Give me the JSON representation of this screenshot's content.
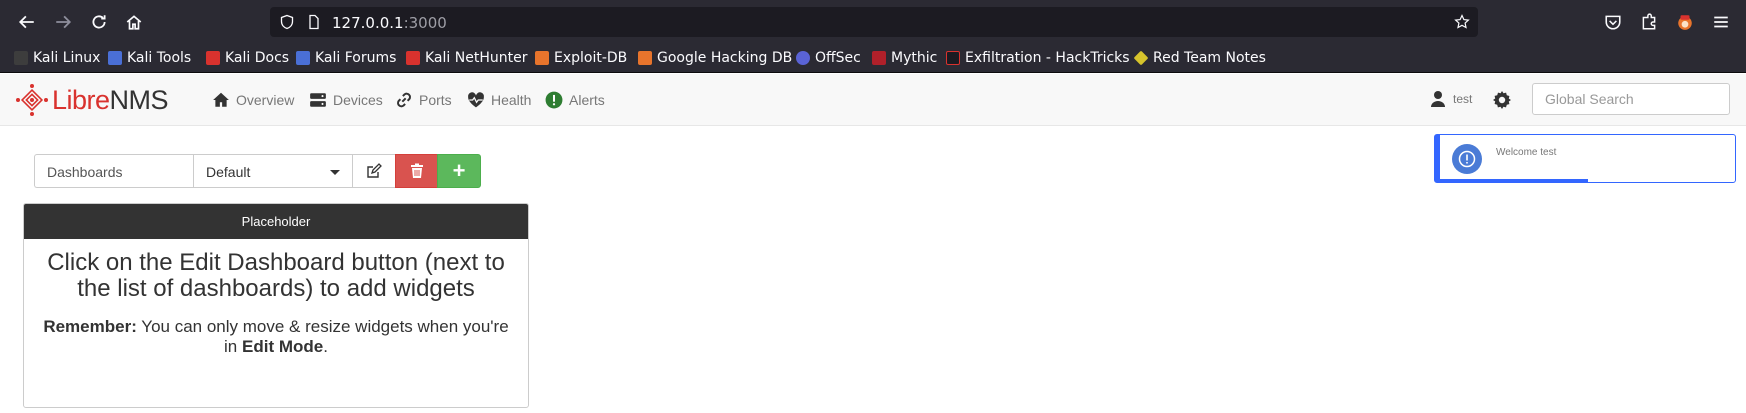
{
  "browser": {
    "url_host": "127.0.0.1",
    "url_port": ":3000",
    "bookmarks": [
      {
        "label": "Kali Linux",
        "color": "#3d3d3d"
      },
      {
        "label": "Kali Tools",
        "color": "#4a6fd6"
      },
      {
        "label": "Kali Docs",
        "color": "#d9322e"
      },
      {
        "label": "Kali Forums",
        "color": "#4a6fd6"
      },
      {
        "label": "Kali NetHunter",
        "color": "#d9322e"
      },
      {
        "label": "Exploit-DB",
        "color": "#e8742c"
      },
      {
        "label": "Google Hacking DB",
        "color": "#e8742c"
      },
      {
        "label": "OffSec",
        "color": "#5a63d6"
      },
      {
        "label": "Mythic",
        "color": "#b0202a"
      },
      {
        "label": "Exfiltration - HackTricks",
        "color": "#d9322e"
      },
      {
        "label": "Red Team Notes",
        "color": "#d6c32c"
      }
    ]
  },
  "navbar": {
    "logo_libre": "Libre",
    "logo_nms": "NMS",
    "items": [
      {
        "label": "Overview",
        "icon": "home-icon"
      },
      {
        "label": "Devices",
        "icon": "server-icon"
      },
      {
        "label": "Ports",
        "icon": "link-icon"
      },
      {
        "label": "Health",
        "icon": "heartbeat-icon"
      },
      {
        "label": "Alerts",
        "icon": "exclamation-circle-icon"
      }
    ],
    "user": "test",
    "search_placeholder": "Global Search"
  },
  "dashboard": {
    "label": "Dashboards",
    "selected": "Default",
    "add_label": "+"
  },
  "panel": {
    "title": "Placeholder",
    "heading": "Click on the Edit Dashboard button (next to the list of dashboards) to add widgets",
    "remember_label": "Remember:",
    "remember_text": " You can only move & resize widgets when you're in ",
    "edit_mode": "Edit Mode",
    "period": "."
  },
  "toast": {
    "message": "Welcome test",
    "progress": 0.5
  }
}
